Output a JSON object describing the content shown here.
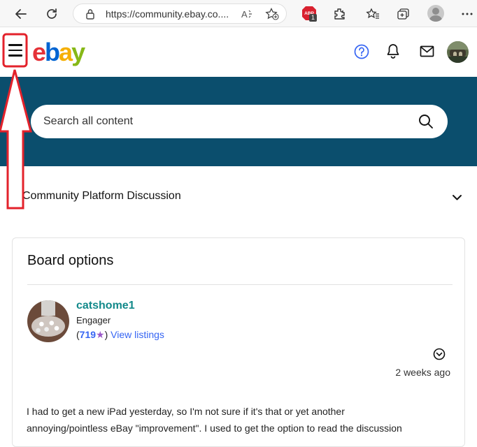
{
  "browser": {
    "url": "https://community.ebay.co....",
    "extension_badge": "1",
    "extension_label": "ABP",
    "colors": {
      "toolbar": "#f7f7f7"
    }
  },
  "header": {
    "logo": {
      "e": "e",
      "b": "b",
      "a": "a",
      "y": "y"
    },
    "logo_colors": {
      "e": "#e53238",
      "b": "#0064d2",
      "a": "#f5af02",
      "y": "#86b817"
    },
    "icons": [
      "menu-icon",
      "help-icon",
      "bell-icon",
      "mail-icon",
      "avatar"
    ]
  },
  "hero": {
    "search_placeholder": "Search all content",
    "background": "#0b4e6d"
  },
  "board": {
    "title": "Community Platform Discussion"
  },
  "card": {
    "title": "Board options",
    "author": {
      "username": "catshome1",
      "rank": "Engager",
      "feedback_open": "(",
      "feedback_score": "719",
      "feedback_close": ")",
      "view_listings": "View listings"
    },
    "post_time": "2 weeks ago",
    "post_body_line1": "I had to get a new iPad yesterday, so I'm not sure if it's that or yet another",
    "post_body_line2": "annoying/pointless eBay \"improvement\".  I used to get the option to read the discussion"
  },
  "annotation": {
    "color": "#e3222b"
  }
}
